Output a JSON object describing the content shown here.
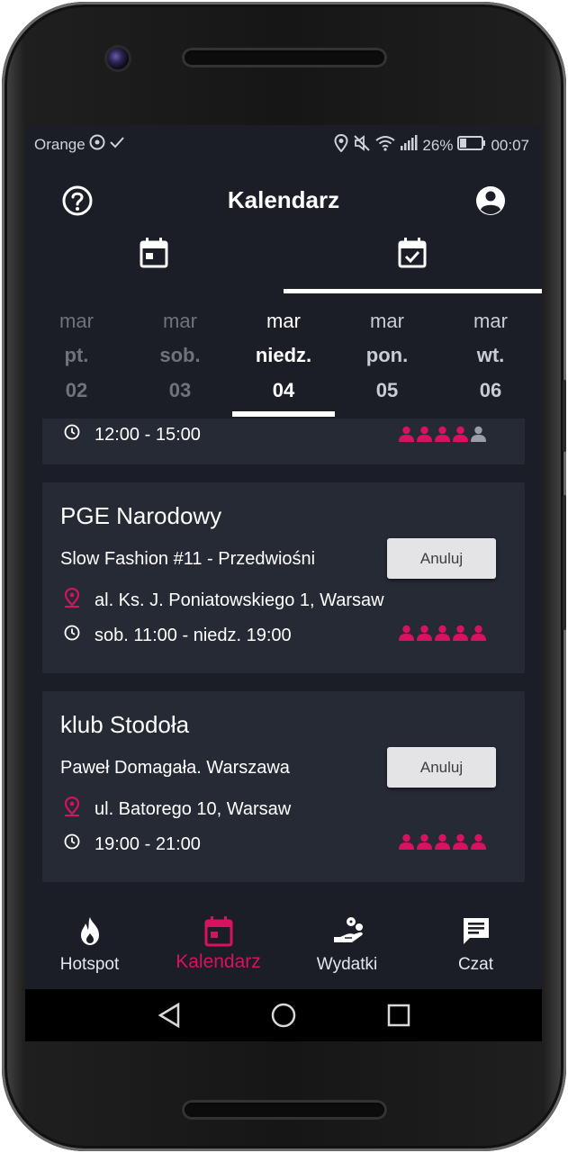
{
  "status": {
    "carrier": "Orange",
    "battery": "26%",
    "time": "00:07"
  },
  "header": {
    "title": "Kalendarz"
  },
  "view_tabs": [
    {
      "icon": "calendar-icon"
    },
    {
      "icon": "calendar-check-icon",
      "selected": true
    }
  ],
  "dates": [
    {
      "month": "mar",
      "day": "pt.",
      "num": "02"
    },
    {
      "month": "mar",
      "day": "sob.",
      "num": "03"
    },
    {
      "month": "mar",
      "day": "niedz.",
      "num": "04",
      "selected": true
    },
    {
      "month": "mar",
      "day": "pon.",
      "num": "05"
    },
    {
      "month": "mar",
      "day": "wt.",
      "num": "06"
    }
  ],
  "events": [
    {
      "time": "12:00 - 15:00",
      "attendance": 4
    },
    {
      "venue": "PGE Narodowy",
      "name": "Slow Fashion #11 - Przedwiośni",
      "address": "al. Ks. J. Poniatowskiego 1, Warsaw",
      "time": "sob. 11:00 - niedz. 19:00",
      "cancel_label": "Anuluj",
      "attendance": 5
    },
    {
      "venue": "klub Stodoła",
      "name": "Paweł Domagała. Warszawa",
      "address": "ul. Batorego 10, Warsaw",
      "time": "19:00 - 21:00",
      "cancel_label": "Anuluj",
      "attendance": 5
    }
  ],
  "attendance_max": 5,
  "bottom_nav": [
    {
      "label": "Hotspot",
      "icon": "fire-icon"
    },
    {
      "label": "Kalendarz",
      "icon": "calendar-icon",
      "selected": true
    },
    {
      "label": "Wydatki",
      "icon": "hand-coins-icon"
    },
    {
      "label": "Czat",
      "icon": "chat-icon"
    }
  ],
  "colors": {
    "accent": "#d8125e",
    "background": "#1b1e26",
    "card": "#262a35",
    "button": "#e4e4e6"
  }
}
